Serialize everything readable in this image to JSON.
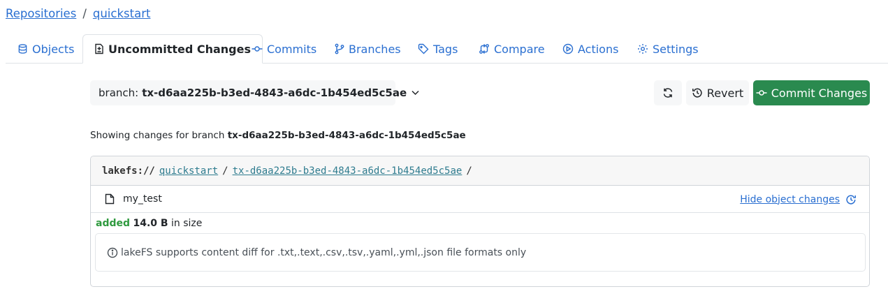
{
  "breadcrumb": {
    "root": "Repositories",
    "separator": "/",
    "repo": "quickstart"
  },
  "tabs": [
    {
      "label": "Objects",
      "icon": "database-icon"
    },
    {
      "label": "Uncommitted Changes",
      "icon": "file-diff-icon",
      "active": true
    },
    {
      "label": "Commits",
      "icon": "commit-icon"
    },
    {
      "label": "Branches",
      "icon": "branch-icon"
    },
    {
      "label": "Tags",
      "icon": "tag-icon"
    },
    {
      "label": "Compare",
      "icon": "compare-icon"
    },
    {
      "label": "Actions",
      "icon": "play-icon"
    },
    {
      "label": "Settings",
      "icon": "gear-icon"
    }
  ],
  "toolbar": {
    "branch_prefix": "branch:",
    "branch_id": "tx-d6aa225b-b3ed-4843-a6dc-1b454ed5c5ae",
    "revert_label": "Revert",
    "commit_label": "Commit Changes"
  },
  "showing": {
    "text": "Showing changes for branch",
    "branch": "tx-d6aa225b-b3ed-4843-a6dc-1b454ed5c5ae"
  },
  "changes": {
    "protocol": "lakefs://",
    "repo": "quickstart",
    "branch": "tx-d6aa225b-b3ed-4843-a6dc-1b454ed5c5ae",
    "trailing_slash": "/",
    "entry": {
      "name": "my_test",
      "toggle_label": "Hide object changes"
    },
    "status": "added",
    "size": "14.0 B",
    "size_suffix": "in size",
    "info": "lakeFS supports content diff for .txt,.text,.csv,.tsv,.yaml,.yml,.json file formats only"
  },
  "colors": {
    "link": "#2a6fd1",
    "commit_button": "#2a8a4f",
    "added": "#2f9a3f"
  }
}
